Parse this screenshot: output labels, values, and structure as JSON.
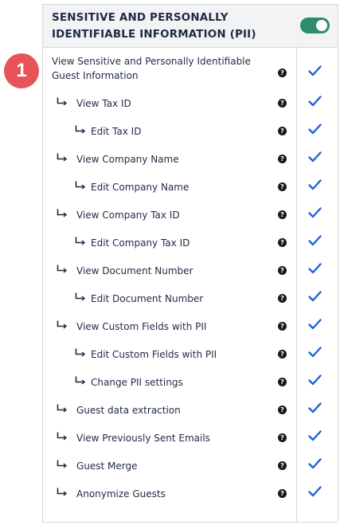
{
  "header": {
    "title": "SENSITIVE AND PERSONALLY IDENTIFIABLE INFORMATION (PII)",
    "toggle_on": true
  },
  "badge": "1",
  "help_glyph": "?",
  "permissions": [
    {
      "label": "View Sensitive and Personally Identifiable Guest Information",
      "level": 0,
      "checked": true
    },
    {
      "label": "View Tax ID",
      "level": 1,
      "checked": true
    },
    {
      "label": "Edit Tax ID",
      "level": 2,
      "checked": true
    },
    {
      "label": "View Company Name",
      "level": 1,
      "checked": true
    },
    {
      "label": "Edit Company Name",
      "level": 2,
      "checked": true
    },
    {
      "label": "View Company Tax ID",
      "level": 1,
      "checked": true
    },
    {
      "label": "Edit Company Tax ID",
      "level": 2,
      "checked": true
    },
    {
      "label": "View Document Number",
      "level": 1,
      "checked": true
    },
    {
      "label": "Edit Document Number",
      "level": 2,
      "checked": true
    },
    {
      "label": "View Custom Fields with PII",
      "level": 1,
      "checked": true
    },
    {
      "label": "Edit Custom Fields with PII",
      "level": 2,
      "checked": true
    },
    {
      "label": "Change PII settings",
      "level": 2,
      "checked": true
    },
    {
      "label": "Guest data extraction",
      "level": 1,
      "checked": true
    },
    {
      "label": "View Previously Sent Emails",
      "level": 1,
      "checked": true
    },
    {
      "label": "Guest Merge",
      "level": 1,
      "checked": true
    },
    {
      "label": "Anonymize Guests",
      "level": 1,
      "checked": true
    }
  ],
  "colors": {
    "toggle": "#2e8b6b",
    "check": "#1e63d6",
    "badge": "#e8535a",
    "text": "#1f2a44"
  },
  "icons": {
    "check": "check-icon",
    "help": "help-icon",
    "arrow": "sub-arrow-icon"
  }
}
